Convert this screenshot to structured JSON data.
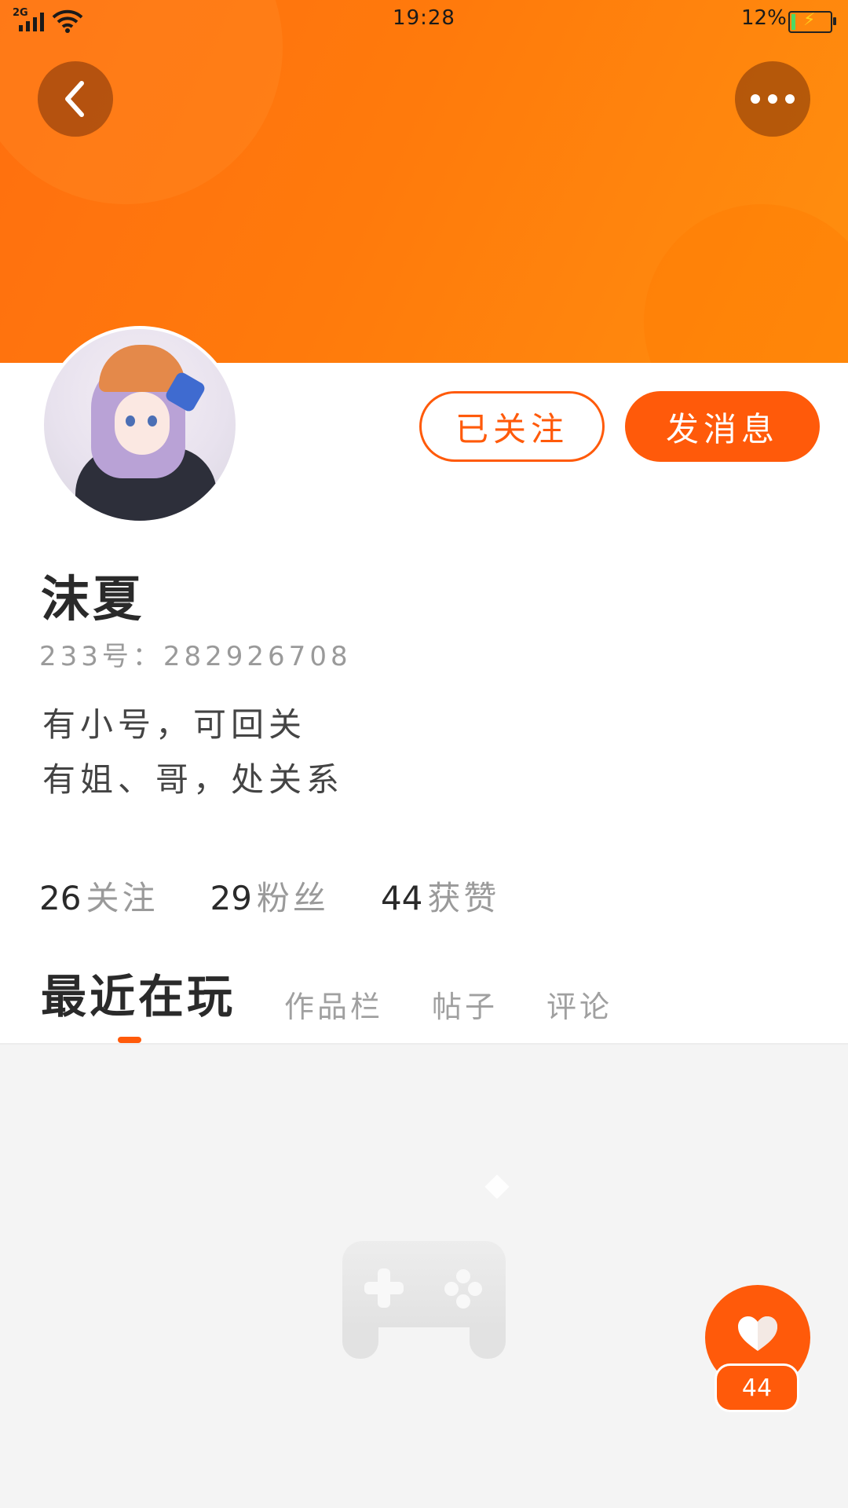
{
  "status_bar": {
    "network_type": "2G",
    "time": "19:28",
    "battery_percent": "12%",
    "battery_level": 0.12
  },
  "header": {
    "back_icon": "chevron-left-icon",
    "more_icon": "more-horizontal-icon"
  },
  "profile": {
    "avatar_icon": "avatar-anime-girl",
    "name": "沫夏",
    "uid": "233号：282926708",
    "bio_lines": [
      "有小号，可回关",
      "有姐、哥，处关系"
    ]
  },
  "actions": {
    "follow_label": "已关注",
    "message_label": "发消息"
  },
  "stats": [
    {
      "value": "26",
      "label": "关注"
    },
    {
      "value": "29",
      "label": "粉丝"
    },
    {
      "value": "44",
      "label": "获赞"
    }
  ],
  "tabs": [
    {
      "label": "最近在玩",
      "active": true
    },
    {
      "label": "作品栏",
      "active": false
    },
    {
      "label": "帖子",
      "active": false
    },
    {
      "label": "评论",
      "active": false
    }
  ],
  "empty_state_icon": "gamepad-icon",
  "like_button": {
    "icon": "heart-icon",
    "count": "44"
  },
  "colors": {
    "accent": "#ff5a0a",
    "banner_start": "#ff6f0f",
    "banner_end": "#ff8f0e",
    "text_primary": "#2a2a2a",
    "text_secondary": "#9a9a9a",
    "content_bg": "#f4f4f4"
  }
}
